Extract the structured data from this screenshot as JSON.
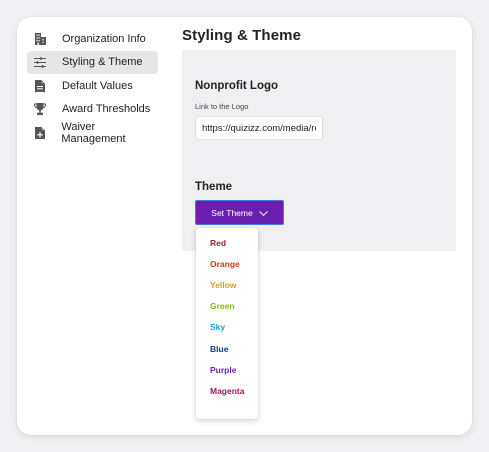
{
  "sidebar": {
    "items": [
      {
        "label": "Organization Info",
        "icon": "building-icon",
        "active": false
      },
      {
        "label": "Styling & Theme",
        "icon": "sliders-icon",
        "active": true
      },
      {
        "label": "Default Values",
        "icon": "document-icon",
        "active": false
      },
      {
        "label": "Award Thresholds",
        "icon": "trophy-icon",
        "active": false
      },
      {
        "label": "Waiver Management",
        "icon": "document-plus-icon",
        "active": false
      }
    ]
  },
  "main": {
    "title": "Styling & Theme",
    "logo_section": {
      "title": "Nonprofit Logo",
      "field_label": "Link to the Logo",
      "value": "https://quizizz.com/media/re"
    },
    "theme_section": {
      "title": "Theme",
      "button_label": "Set Theme"
    }
  },
  "theme_menu": {
    "options": [
      {
        "label": "Red",
        "color": "#a6192e"
      },
      {
        "label": "Orange",
        "color": "#c2410c"
      },
      {
        "label": "Yellow",
        "color": "#c9a227"
      },
      {
        "label": "Green",
        "color": "#74c21f"
      },
      {
        "label": "Sky",
        "color": "#1ea3d8"
      },
      {
        "label": "Blue",
        "color": "#0b3d86"
      },
      {
        "label": "Purple",
        "color": "#6b1fb1"
      },
      {
        "label": "Magenta",
        "color": "#a0185a"
      }
    ]
  },
  "colors": {
    "accent": "#6b1fb1",
    "focus_ring": "#3f7be0",
    "panel_bg": "#f0f0f2"
  }
}
